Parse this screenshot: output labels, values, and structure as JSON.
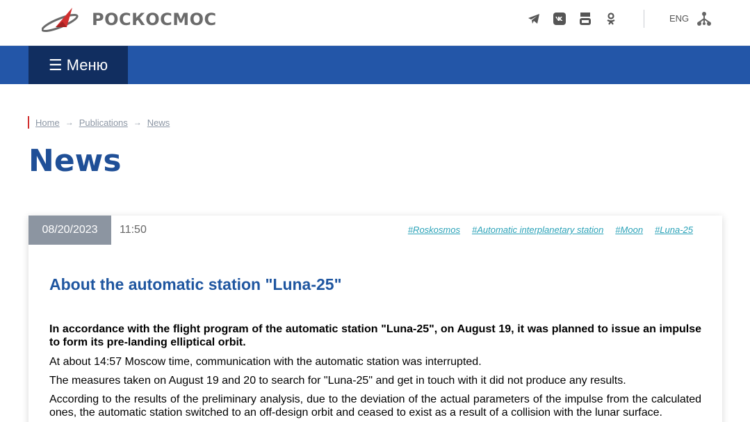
{
  "header": {
    "logo_text": "РОСКОСМОС",
    "language": "ENG",
    "social_icons": [
      "telegram-icon",
      "vk-icon",
      "youtube-icon",
      "odnoklassniki-icon"
    ],
    "colors": {
      "brand_red": "#d12f2f",
      "nav_blue": "#2356a8",
      "menu_dark": "#112e60"
    }
  },
  "nav": {
    "menu_label": "☰ Меню"
  },
  "breadcrumb": {
    "items": [
      "Home",
      "Publications",
      "News"
    ],
    "separator": "→"
  },
  "page": {
    "title": "News"
  },
  "article": {
    "date": "08/20/2023",
    "time": "11:50",
    "tags": [
      "#Roskosmos",
      "#Automatic interplanetary station",
      "#Moon",
      "#Luna-25"
    ],
    "title": "About the automatic station \"Luna-25\"",
    "lead": "In accordance with the flight program of the automatic station \"Luna-25\", on August 19, it was planned to issue an impulse to form its pre-landing elliptical orbit.",
    "paragraphs": [
      "At about 14:57 Moscow time, communication with the automatic station was interrupted.",
      "The measures taken on August 19 and 20 to search for \"Luna-25\" and get in touch with it did not produce any results.",
      "According to the results of the preliminary analysis, due to the deviation of the actual parameters of the impulse from the calculated ones, the automatic station switched to an off-design orbit and ceased to exist as a result of a collision with the lunar surface."
    ]
  }
}
